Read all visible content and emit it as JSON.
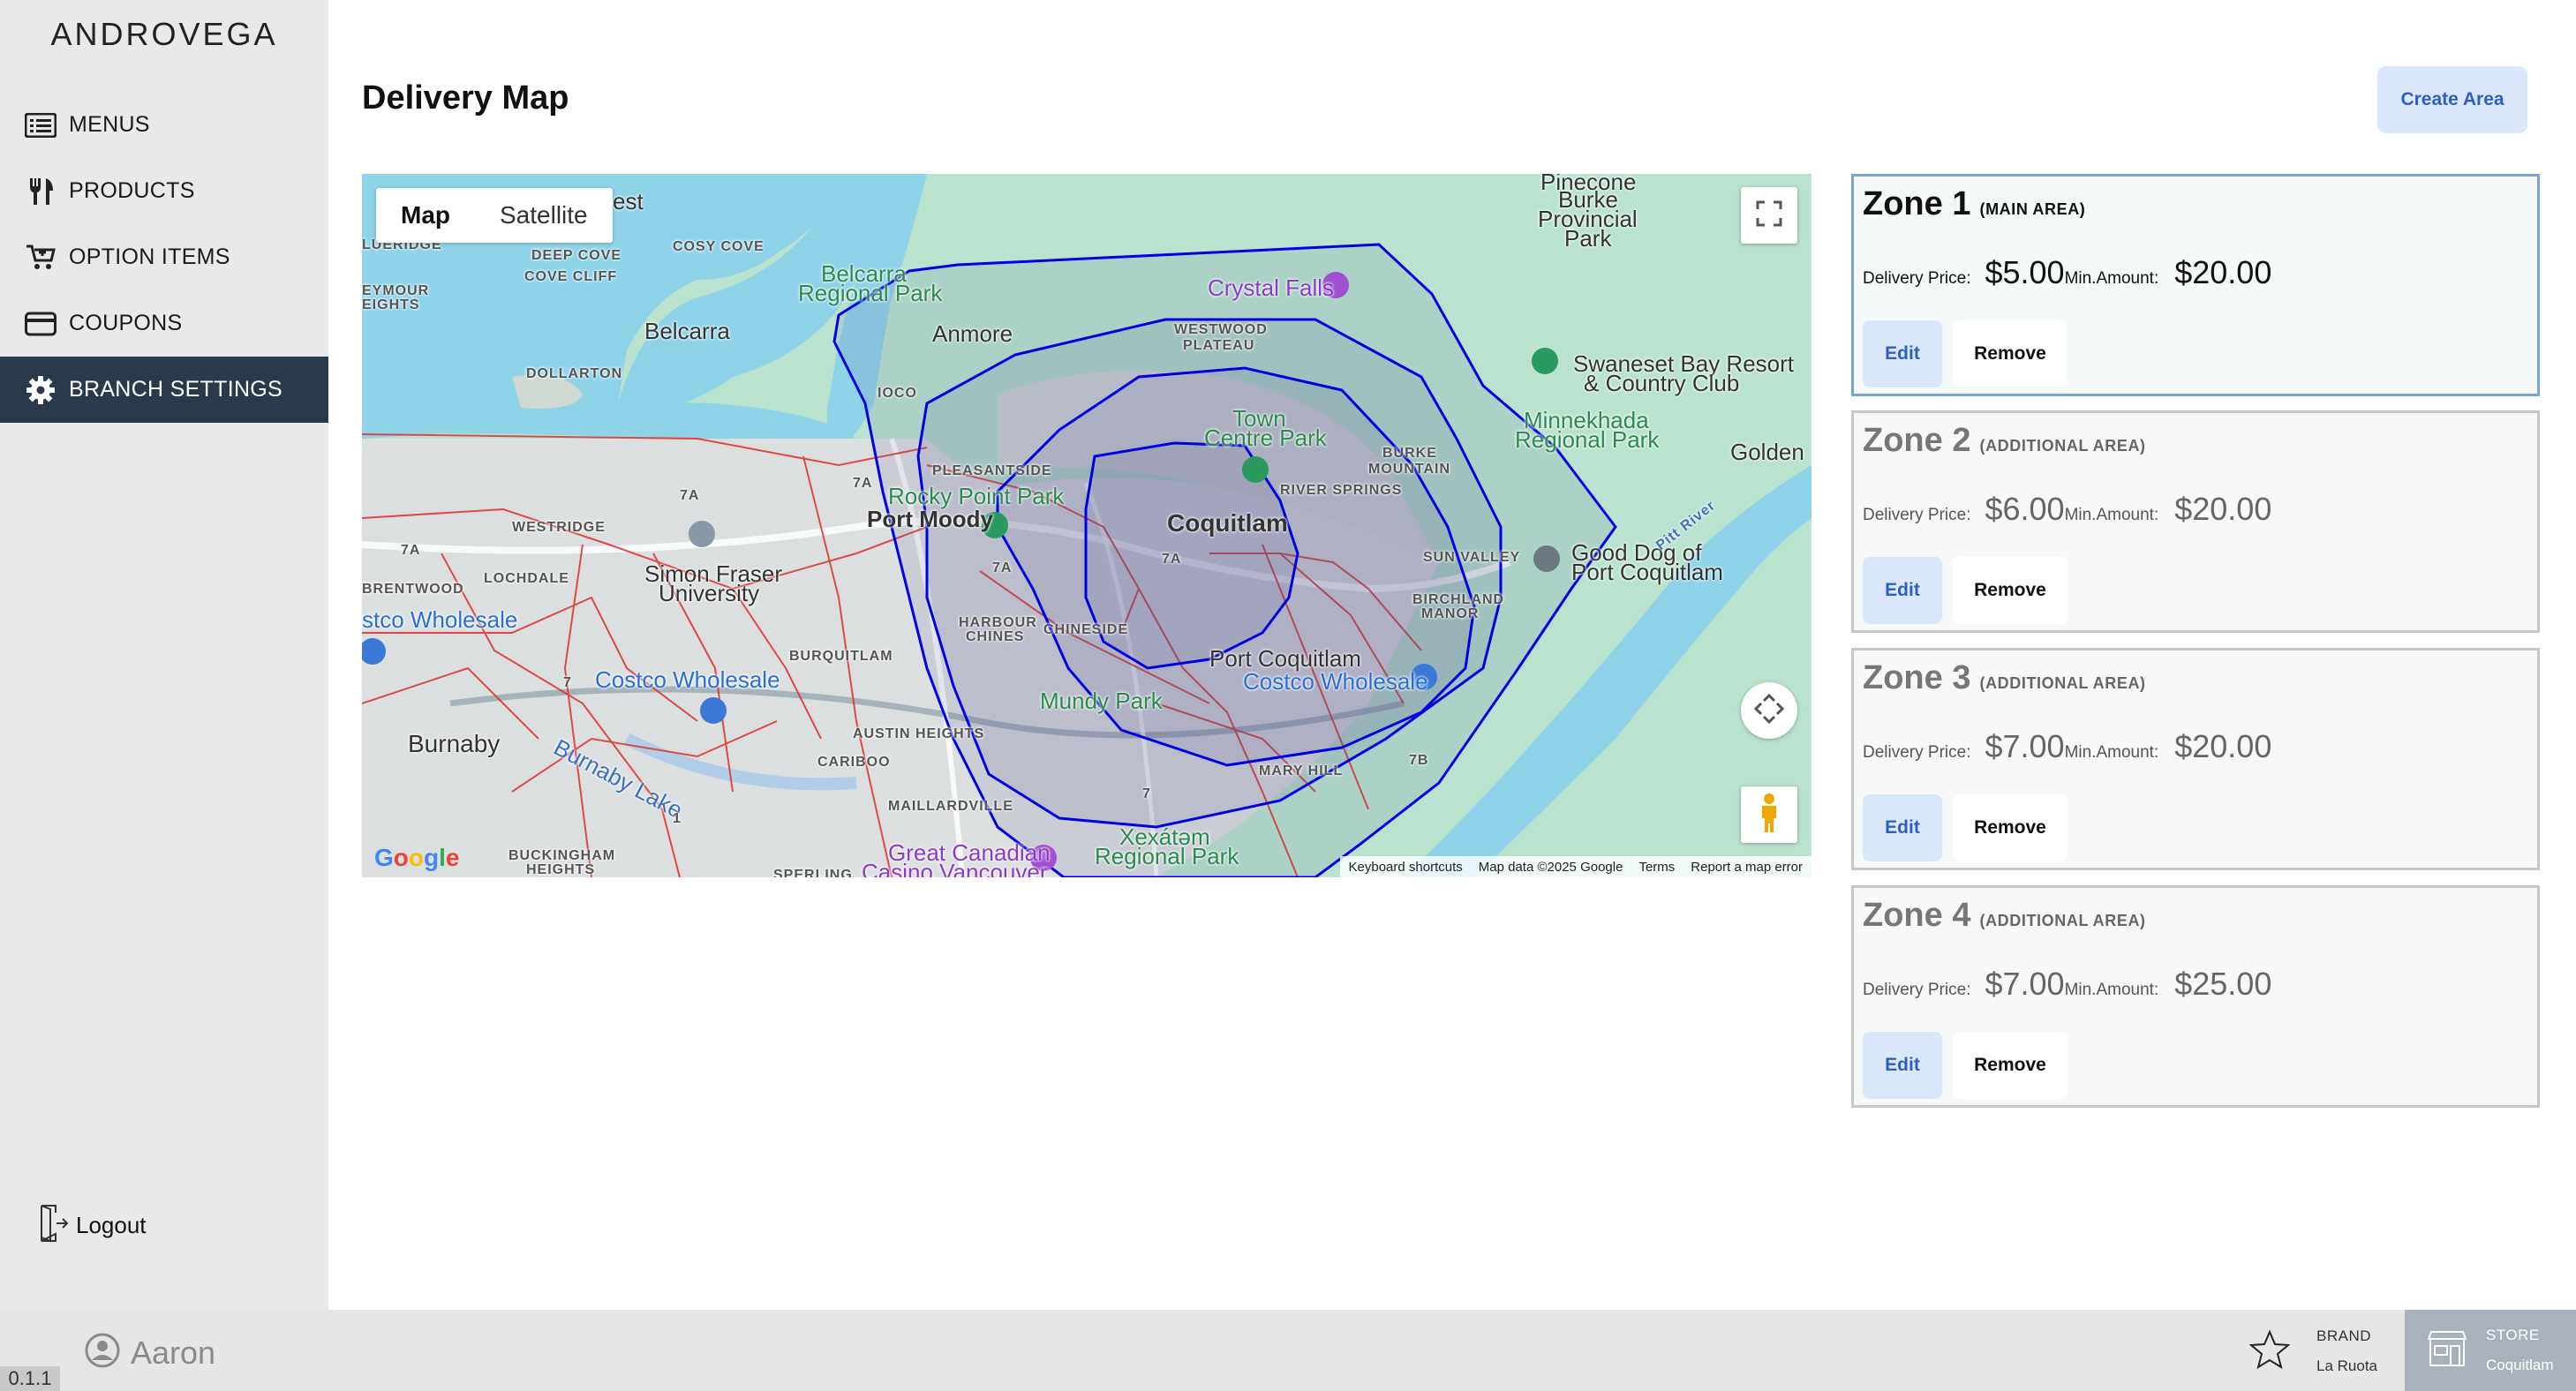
{
  "app": {
    "logo": "ANDROVEGA",
    "version": "0.1.1"
  },
  "sidebar": {
    "items": [
      {
        "label": "MENUS",
        "icon": "menu-list-icon",
        "active": false
      },
      {
        "label": "PRODUCTS",
        "icon": "fork-knife-icon",
        "active": false
      },
      {
        "label": "OPTION ITEMS",
        "icon": "cart-plus-icon",
        "active": false
      },
      {
        "label": "COUPONS",
        "icon": "credit-card-icon",
        "active": true
      },
      {
        "label": "BRANCH SETTINGS",
        "icon": "gear-icon",
        "active": true
      }
    ],
    "logout_label": "Logout"
  },
  "user": {
    "name": "Aaron"
  },
  "footer": {
    "brand_label": "BRAND",
    "brand_value": "La Ruota",
    "store_label": "STORE",
    "store_value": "Coquitlam"
  },
  "header": {
    "title": "Delivery Map",
    "create_label": "Create Area"
  },
  "map": {
    "type_map": "Map",
    "type_satellite": "Satellite",
    "labels": {
      "pinecone": "Pinecone",
      "burke": "Burke",
      "provincial": "Provincial",
      "park": "Park",
      "crystal_falls": "Crystal Falls",
      "belcarra_regional": "Belcarra",
      "regional_park": "Regional Park",
      "anmore": "Anmore",
      "belcarra": "Belcarra",
      "cosy_cove": "COSY COVE",
      "deep_cove": "DEEP COVE",
      "cove_cliff": "COVE CLIFF",
      "dollarton": "DOLLARTON",
      "ioco": "IOCO",
      "westwood_plateau": "WESTWOOD",
      "plateau": "PLATEAU",
      "town_centre": "Town",
      "centre_park": "Centre Park",
      "swaneset": "Swaneset Bay Resort",
      "country_club": "& Country Club",
      "minnekhada": "Minnekhada",
      "minnekhada_park": "Regional Park",
      "golden_ears": "Golden Ea",
      "burke_mountain": "BURKE",
      "mountain": "MOUNTAIN",
      "river_springs": "RIVER SPRINGS",
      "pleasantside": "PLEASANTSIDE",
      "rocky_point": "Rocky Point Park",
      "port_moody": "Port Moody",
      "coquitlam": "Coquitlam",
      "sun_valley": "SUN VALLEY",
      "good_dog": "Good Dog of",
      "port_coquitlam_name": "Port Coquitlam",
      "westridge": "WESTRIDGE",
      "lochdale": "LOCHDALE",
      "brentwood": "BRENTWOOD",
      "costco_left": "stco Wholesale",
      "sfu": "Simon Fraser",
      "university": "University",
      "harbour_chines": "HARBOUR",
      "chines": "CHINES",
      "chineside": "CHINESIDE",
      "birchland": "BIRCHLAND",
      "manor": "MANOR",
      "port_coquitlam": "Port Coquitlam",
      "costco_mid": "Costco Wholesale",
      "costco_right": "Costco Wholesale",
      "burquitlam": "BURQUITLAM",
      "mundy_park": "Mundy Park",
      "austin_heights": "AUSTIN HEIGHTS",
      "cariboo": "CARIBOO",
      "burnaby": "Burnaby",
      "burnaby_lake": "Burnaby Lake",
      "mary_hill": "MARY HILL",
      "maillardville": "MAILLARDVILLE",
      "great_canadian": "Great Canadian",
      "casino": "Casino Vancouver",
      "xexatam": "Xexátəm",
      "xexatam_park": "Regional Park",
      "buckingham": "BUCKINGHAM",
      "heights": "HEIGHTS",
      "sperling": "SPERLING",
      "eymour": "EYMOUR",
      "eights": "EIGHTS",
      "lueridge": "LUERIDGE",
      "est": "est",
      "pitt_river": "Pitt River",
      "hwy_7a_1": "7A",
      "hwy_7a_2": "7A",
      "hwy_7a_3": "7A",
      "hwy_7a_4": "7A",
      "hwy_7a_5": "7A",
      "hwy_7": "7",
      "hwy_7_2": "7",
      "hwy_7b": "7B",
      "hwy_1": "1"
    },
    "footer": {
      "shortcuts": "Keyboard shortcuts",
      "data": "Map data ©2025 Google",
      "terms": "Terms",
      "report": "Report a map error"
    },
    "google_logo": "Google"
  },
  "zones": [
    {
      "name": "Zone 1",
      "type": "(MAIN AREA)",
      "price_label": "Delivery Price:",
      "price": "$5.00",
      "min_label": "Min.Amount:",
      "min": "$20.00",
      "edit": "Edit",
      "remove": "Remove"
    },
    {
      "name": "Zone 2",
      "type": "(ADDITIONAL AREA)",
      "price_label": "Delivery Price:",
      "price": "$6.00",
      "min_label": "Min.Amount:",
      "min": "$20.00",
      "edit": "Edit",
      "remove": "Remove"
    },
    {
      "name": "Zone 3",
      "type": "(ADDITIONAL AREA)",
      "price_label": "Delivery Price:",
      "price": "$7.00",
      "min_label": "Min.Amount:",
      "min": "$20.00",
      "edit": "Edit",
      "remove": "Remove"
    },
    {
      "name": "Zone 4",
      "type": "(ADDITIONAL AREA)",
      "price_label": "Delivery Price:",
      "price": "$7.00",
      "min_label": "Min.Amount:",
      "min": "$25.00",
      "edit": "Edit",
      "remove": "Remove"
    }
  ],
  "colors": {
    "sidebar_active": "#2b3a4a",
    "accent_button": "#dbe8fb",
    "accent_text": "#2d5fc0",
    "zone_border": "#0000e0",
    "region_lines": "#e0302a"
  }
}
